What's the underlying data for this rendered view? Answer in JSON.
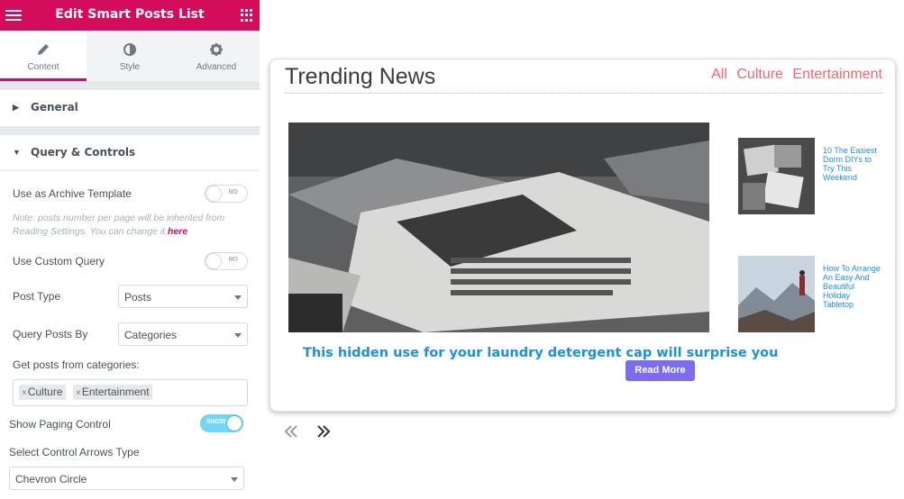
{
  "topbar": {
    "title": "Edit Smart Posts List",
    "menu_icon": "hamburger-icon",
    "grid_icon": "apps-grid-icon",
    "color": "#d30c5c"
  },
  "tabs": [
    {
      "label": "Content",
      "icon": "pencil-icon",
      "active": true
    },
    {
      "label": "Style",
      "icon": "half-circle-icon"
    },
    {
      "label": "Advanced",
      "icon": "gear-icon"
    }
  ],
  "sections": {
    "general": "General",
    "query": "Query & Controls"
  },
  "controls": {
    "archive_label": "Use as Archive Template",
    "archive_toggle": "NO",
    "note_text": "Note: posts number per page will be inherited from Reading Settings. You can change it",
    "note_link": "here",
    "custom_query_label": "Use Custom Query",
    "custom_query_toggle": "NO",
    "post_type_label": "Post Type",
    "post_type_value": "Posts",
    "query_by_label": "Query Posts By",
    "query_by_value": "Categories",
    "categories_label": "Get posts from categories:",
    "categories": [
      "Culture",
      "Entertainment"
    ],
    "paging_label": "Show Paging Control",
    "paging_toggle": "SHOW",
    "arrows_label": "Select Control Arrows Type",
    "arrows_value": "Chevron Circle"
  },
  "preview": {
    "title": "Trending News",
    "filters": [
      "All",
      "Culture",
      "Entertainment"
    ],
    "main_post": {
      "title": "This hidden use for your laundry detergent cap will surprise you",
      "button": "Read More"
    },
    "side_posts": [
      {
        "title": "10 The Easiest Dorm DIYs to Try This Weekend"
      },
      {
        "title": "How To Arrange An Easy And Beautiful Holiday Tabletop"
      }
    ],
    "accent": "#1a90e4",
    "filter_color": "#f0656d",
    "button_color": "#7c6df0"
  }
}
